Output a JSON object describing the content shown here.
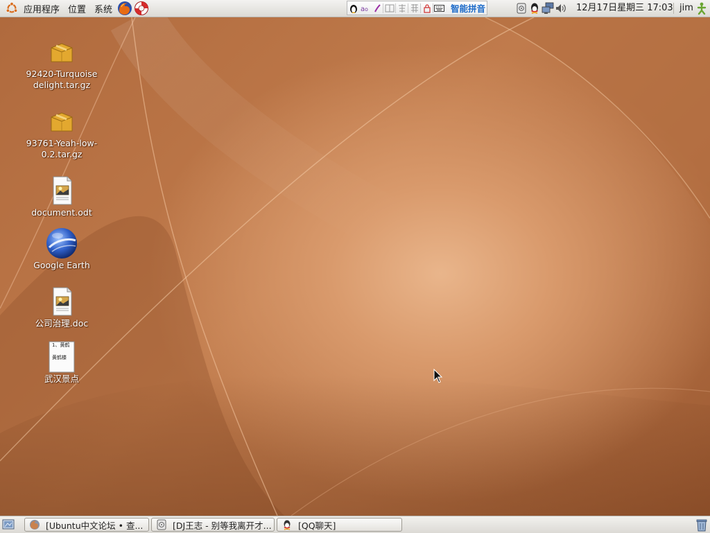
{
  "top_panel": {
    "menus": [
      "应用程序",
      "位置",
      "系统"
    ],
    "launchers": [
      {
        "icon": "firefox-icon",
        "label": "Firefox"
      },
      {
        "icon": "help-lifebuoy-icon",
        "label": "Help"
      }
    ],
    "ime": {
      "icons": [
        "tux-icon",
        "input-mode-icon",
        "punctuation-icon",
        "half-width-icon",
        "simplified-icon",
        "traditional-icon",
        "lock-icon",
        "keyboard-icon"
      ],
      "label": "智能拼音"
    },
    "tray_icons": [
      "disk-icon",
      "qq-icon",
      "network-icon",
      "volume-icon"
    ],
    "clock": "12月17日星期三 17:03",
    "user": "jim"
  },
  "desktop": {
    "icons": [
      {
        "name": "archive-turquoise",
        "type": "archive",
        "label": "92420-Turquoise delight.tar.gz"
      },
      {
        "name": "archive-yeah-low",
        "type": "archive",
        "label": "93761-Yeah-low-0.2.tar.gz"
      },
      {
        "name": "document-odt",
        "type": "document",
        "label": "document.odt"
      },
      {
        "name": "google-earth",
        "type": "earth",
        "label": "Google Earth"
      },
      {
        "name": "company-governance-doc",
        "type": "document",
        "label": "公司治理.doc"
      },
      {
        "name": "wuhan-attractions",
        "type": "text-preview",
        "label": "武汉景点",
        "preview_lines": [
          "1、黄鹤",
          "黄鹤楼"
        ]
      }
    ]
  },
  "bottom_panel": {
    "tasks": [
      {
        "icon": "firefox-icon",
        "label": "[Ubuntu中文论坛 • 查..."
      },
      {
        "icon": "media-player-icon",
        "label": "[DJ王志 - 别等我离开才..."
      },
      {
        "icon": "qq-icon",
        "label": "[QQ聊天]"
      }
    ]
  },
  "colors": {
    "wallpaper_base": "#a9683f",
    "wallpaper_highlight": "#e9b58b",
    "panel_bg": "#e8e6e2",
    "ime_accent": "#1d6bc9"
  }
}
